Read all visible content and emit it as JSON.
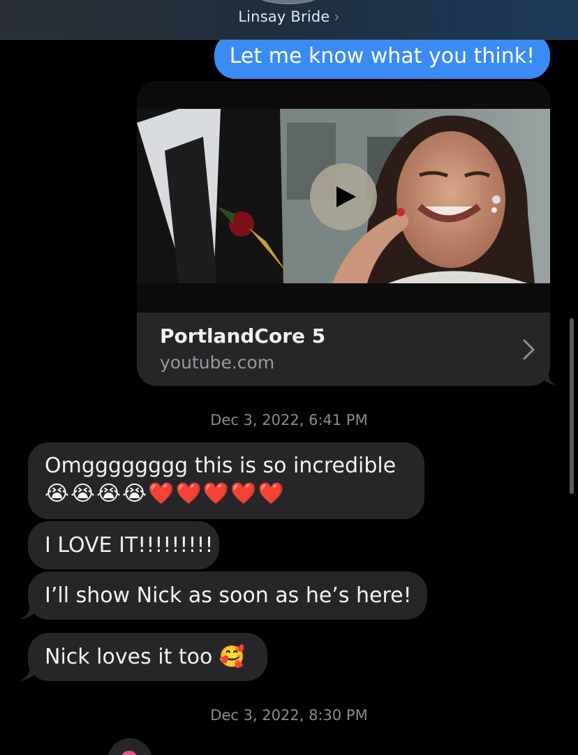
{
  "header": {
    "contact_name": "Linsay Bride",
    "chevron": "›"
  },
  "messages": {
    "sent_1": "Let me know what you think!",
    "link_preview": {
      "title": "PortlandCore 5",
      "domain": "youtube.com",
      "play_icon": "play-icon"
    },
    "timestamp_1": "Dec 3, 2022, 6:41 PM",
    "recv_1_line1": "Omgggggggg this is so incredible",
    "recv_1_line2": "😭😭😭😭❤️❤️❤️❤️❤️",
    "recv_2": "I LOVE IT!!!!!!!!!",
    "recv_3": "I’ll show Nick as soon as he’s here!",
    "recv_4": "Nick loves it too 🥰",
    "timestamp_2": "Dec 3, 2022, 8:30 PM"
  },
  "colors": {
    "sent_bubble": "#3b8bf5",
    "recv_bubble": "#262628",
    "background": "#000000"
  }
}
